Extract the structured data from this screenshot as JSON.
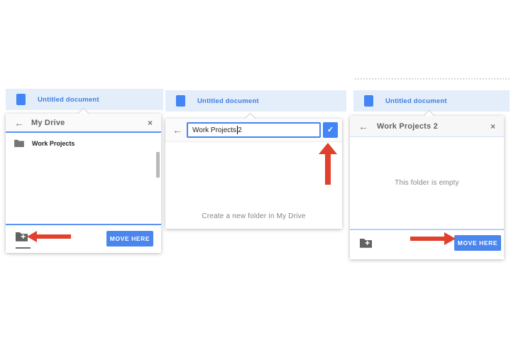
{
  "colors": {
    "titlebar_bg": "#e4eefb",
    "accent_blue": "#4285f4",
    "button_blue": "#4a86ee",
    "divider_blue_strong": "#5b92f2",
    "divider_blue_light": "#b7d0fb",
    "annotation_red": "#e0402c"
  },
  "panels": [
    {
      "titlebar": {
        "doc_title": "Untitled document"
      },
      "dialog": {
        "back_icon": "←",
        "title": "My Drive",
        "close_icon": "×",
        "items": [
          {
            "label": "Work Projects"
          }
        ],
        "move_button": "MOVE HERE"
      }
    },
    {
      "titlebar": {
        "doc_title": "Untitled document"
      },
      "dialog": {
        "back_icon": "←",
        "input": {
          "value": "Work Projects 2",
          "before_cursor": "Work Projects",
          "after_cursor": " 2"
        },
        "confirm_icon": "✓",
        "body_text": "Create a new folder in My Drive"
      }
    },
    {
      "titlebar": {
        "doc_title": "Untitled document"
      },
      "dialog": {
        "back_icon": "←",
        "title": "Work Projects 2",
        "close_icon": "×",
        "body_text": "This folder is empty",
        "move_button": "MOVE HERE"
      }
    }
  ]
}
